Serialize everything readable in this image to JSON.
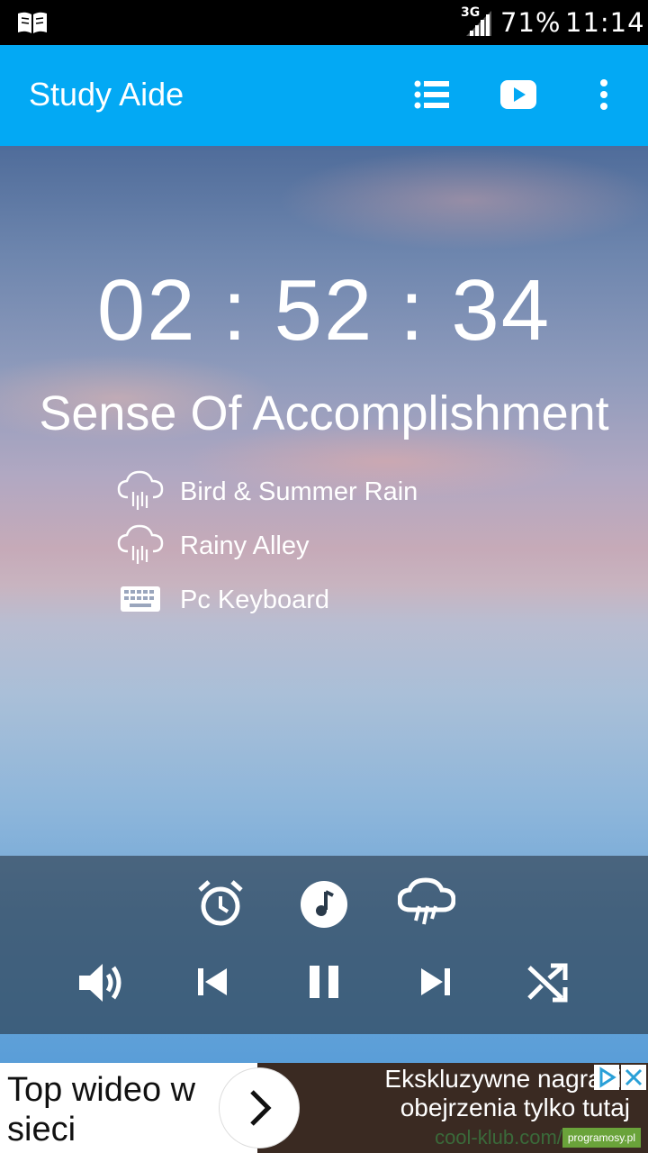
{
  "status_bar": {
    "network": "3G",
    "battery": "71%",
    "time": "11:14"
  },
  "app_bar": {
    "title": "Study Aide",
    "icons": [
      "list-icon",
      "play-video-icon",
      "more-vert-icon"
    ]
  },
  "timer": {
    "display": "02 : 52 : 34"
  },
  "mix": {
    "title": "Sense Of Accomplishment",
    "sounds": [
      {
        "label": "Bird & Summer Rain",
        "icon": "rain-cloud-icon"
      },
      {
        "label": "Rainy Alley",
        "icon": "rain-cloud-icon"
      },
      {
        "label": "Pc Keyboard",
        "icon": "keyboard-icon"
      }
    ]
  },
  "controls": {
    "top_row": [
      "alarm-icon",
      "music-note-icon",
      "rain-cloud-icon"
    ],
    "bottom_row": [
      "volume-icon",
      "skip-previous-icon",
      "pause-icon",
      "skip-next-icon",
      "shuffle-icon"
    ]
  },
  "ad": {
    "left_text": "Top wideo w sieci",
    "line1": "Ekskluzywne nagrania",
    "line2": "obejrzenia tylko tutaj",
    "line3": "cool-klub.com/filmi",
    "badge": "programosy.pl"
  },
  "colors": {
    "app_bar": "#03a9f4",
    "status_bar": "#000000"
  }
}
